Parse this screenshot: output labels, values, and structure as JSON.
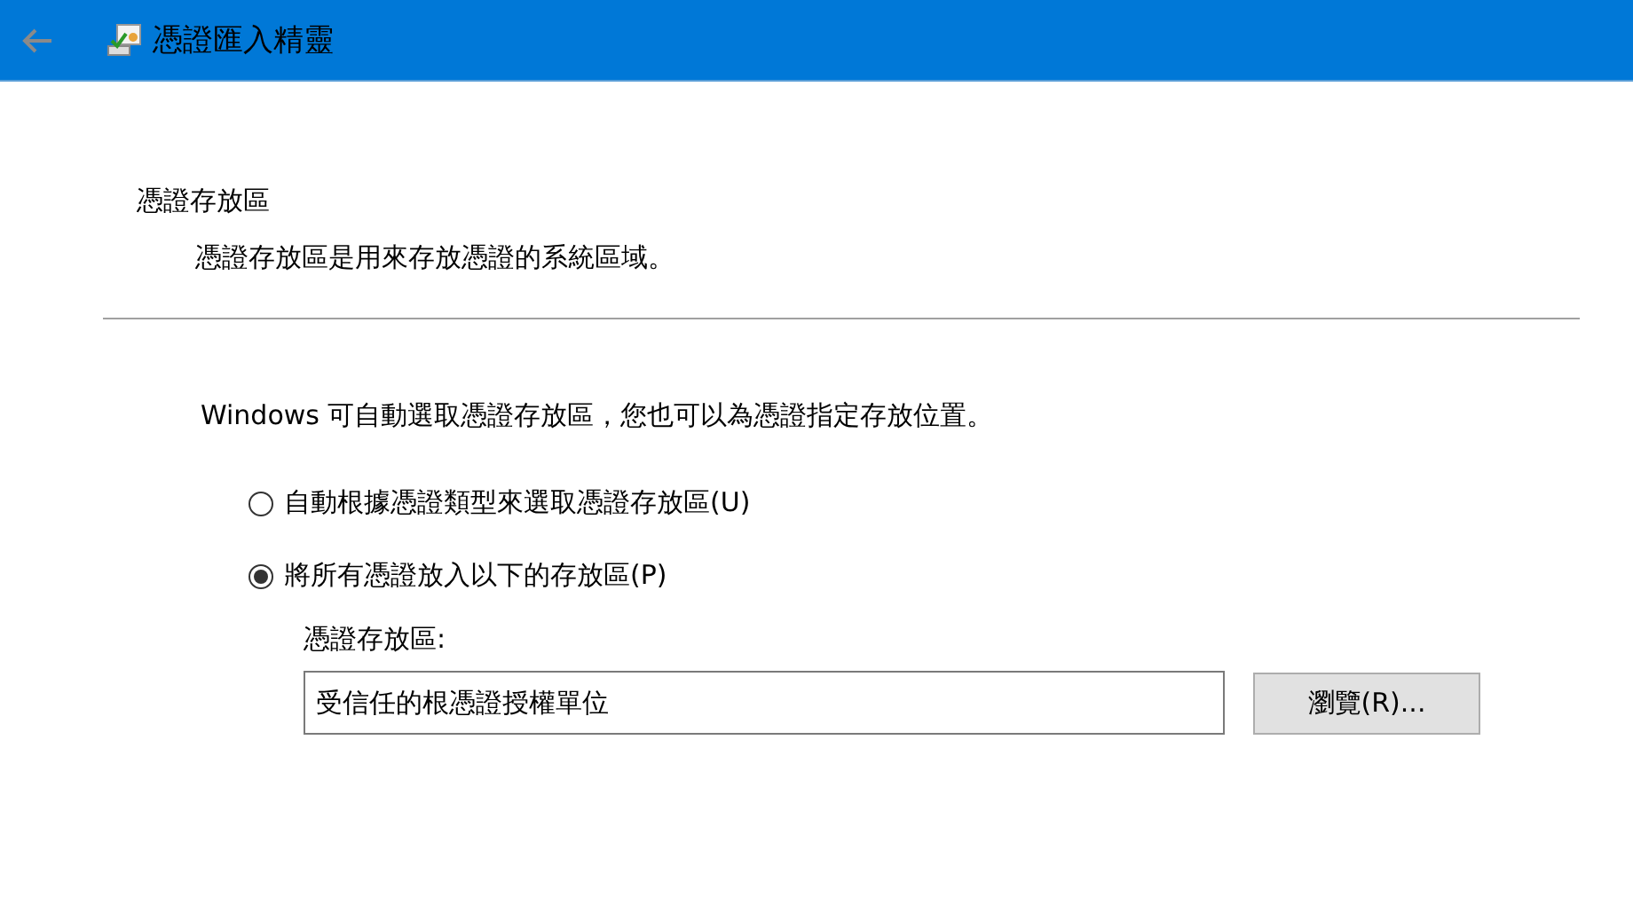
{
  "window": {
    "title": "憑證匯入精靈"
  },
  "header": {
    "title": "憑證存放區",
    "description": "憑證存放區是用來存放憑證的系統區域。"
  },
  "intro": "Windows 可自動選取憑證存放區，您也可以為憑證指定存放位置。",
  "options": [
    {
      "label": "自動根據憑證類型來選取憑證存放區(U)",
      "selected": false
    },
    {
      "label": "將所有憑證放入以下的存放區(P)",
      "selected": true
    }
  ],
  "store": {
    "label": "憑證存放區:",
    "value": "受信任的根憑證授權單位",
    "button": "瀏覽(R)..."
  }
}
